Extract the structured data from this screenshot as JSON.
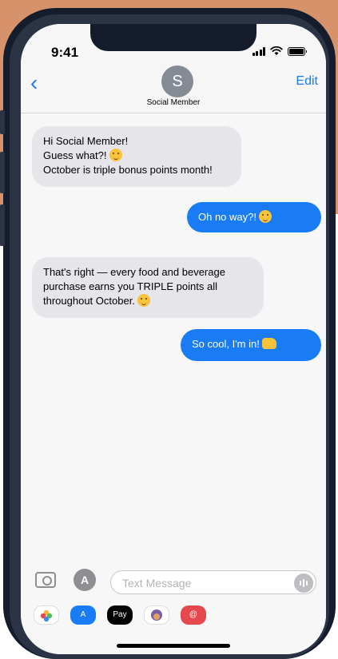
{
  "status_bar": {
    "time": "9:41"
  },
  "header": {
    "back_glyph": "‹",
    "avatar_initial": "S",
    "contact_name": "Social Member",
    "edit_label": "Edit"
  },
  "messages": [
    {
      "direction": "received",
      "lines": [
        "Hi Social Member!",
        "Guess what?!",
        "October is triple bonus points month!"
      ]
    },
    {
      "direction": "sent",
      "lines": [
        "Oh no way?!"
      ]
    },
    {
      "direction": "received",
      "lines": [
        "That's right — every food and beverage",
        "purchase earns you TRIPLE points all",
        "throughout October."
      ]
    },
    {
      "direction": "sent",
      "lines": [
        "So cool, I'm in!"
      ]
    }
  ],
  "composer": {
    "placeholder": "Text Message"
  },
  "app_strip": [
    {
      "name": "photos",
      "label": ""
    },
    {
      "name": "app-store",
      "label": ""
    },
    {
      "name": "apple-pay",
      "label": "Pay"
    },
    {
      "name": "memoji",
      "label": ""
    },
    {
      "name": "search",
      "label": ""
    }
  ],
  "colors": {
    "accent": "#1a7cf5",
    "received_bubble": "#e5e5ea",
    "background": "#d6926a",
    "phone_frame": "#151d2c"
  },
  "icons": [
    "camera-icon",
    "appstore-icon",
    "voice-icon",
    "back-chevron-icon"
  ]
}
